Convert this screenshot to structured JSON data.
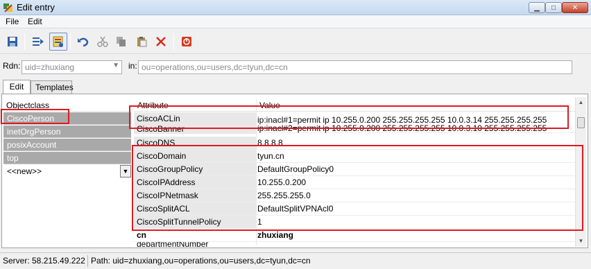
{
  "window": {
    "title": "Edit entry"
  },
  "menu": {
    "file": "File",
    "edit": "Edit"
  },
  "toolbar": {
    "buttons": [
      "save-icon",
      "attributes-icon",
      "template-icon",
      "undo-icon",
      "cut-icon",
      "copy-icon",
      "paste-icon",
      "delete-icon",
      "stop-icon"
    ]
  },
  "rdn": {
    "label": "Rdn:",
    "value": "uid=zhuxiang",
    "in_label": "in:",
    "in_value": "ou=operations,ou=users,dc=tyun,dc=cn"
  },
  "tabs": [
    {
      "label": "Edit",
      "active": true
    },
    {
      "label": "Templates",
      "active": false
    }
  ],
  "objectclass": {
    "header": "Objectclass",
    "items": [
      "CiscoPerson",
      "inetOrgPerson",
      "posixAccount",
      "top"
    ],
    "new_item": "<<new>>"
  },
  "attributes": {
    "header_attr": "Attribute",
    "header_value": "Value",
    "rows": [
      {
        "attr": "CiscoACLin",
        "value": "ip:inacl#1=permit ip 10.255.0.200 255.255.255.255 10.0.3.14 255.255.255.255",
        "value2": "ip:inacl#2=permit ip 10.255.0.200 255.255.255.255 10.0.3.10 255.255.255.255"
      },
      {
        "attr": "CiscoBanner",
        "value": ""
      },
      {
        "attr": "CiscoDNS",
        "value": "8.8.8.8"
      },
      {
        "attr": "CiscoDomain",
        "value": "tyun.cn"
      },
      {
        "attr": "CiscoGroupPolicy",
        "value": "DefaultGroupPolicy0"
      },
      {
        "attr": "CiscoIPAddress",
        "value": "10.255.0.200"
      },
      {
        "attr": "CiscoIPNetmask",
        "value": "255.255.255.0"
      },
      {
        "attr": "CiscoSplitACL",
        "value": "DefaultSplitVPNAcl0"
      },
      {
        "attr": "CiscoSplitTunnelPolicy",
        "value": "1"
      },
      {
        "attr": "cn",
        "value": "zhuxiang"
      },
      {
        "attr": "departmentNumber",
        "value": ""
      }
    ]
  },
  "status": {
    "server": "Server: 58.215.49.222",
    "path": "Path: uid=zhuxiang,ou=operations,ou=users,dc=tyun,dc=cn"
  },
  "colors": {
    "highlight": "#e0191f",
    "selected_row": "#a9a9a9"
  }
}
